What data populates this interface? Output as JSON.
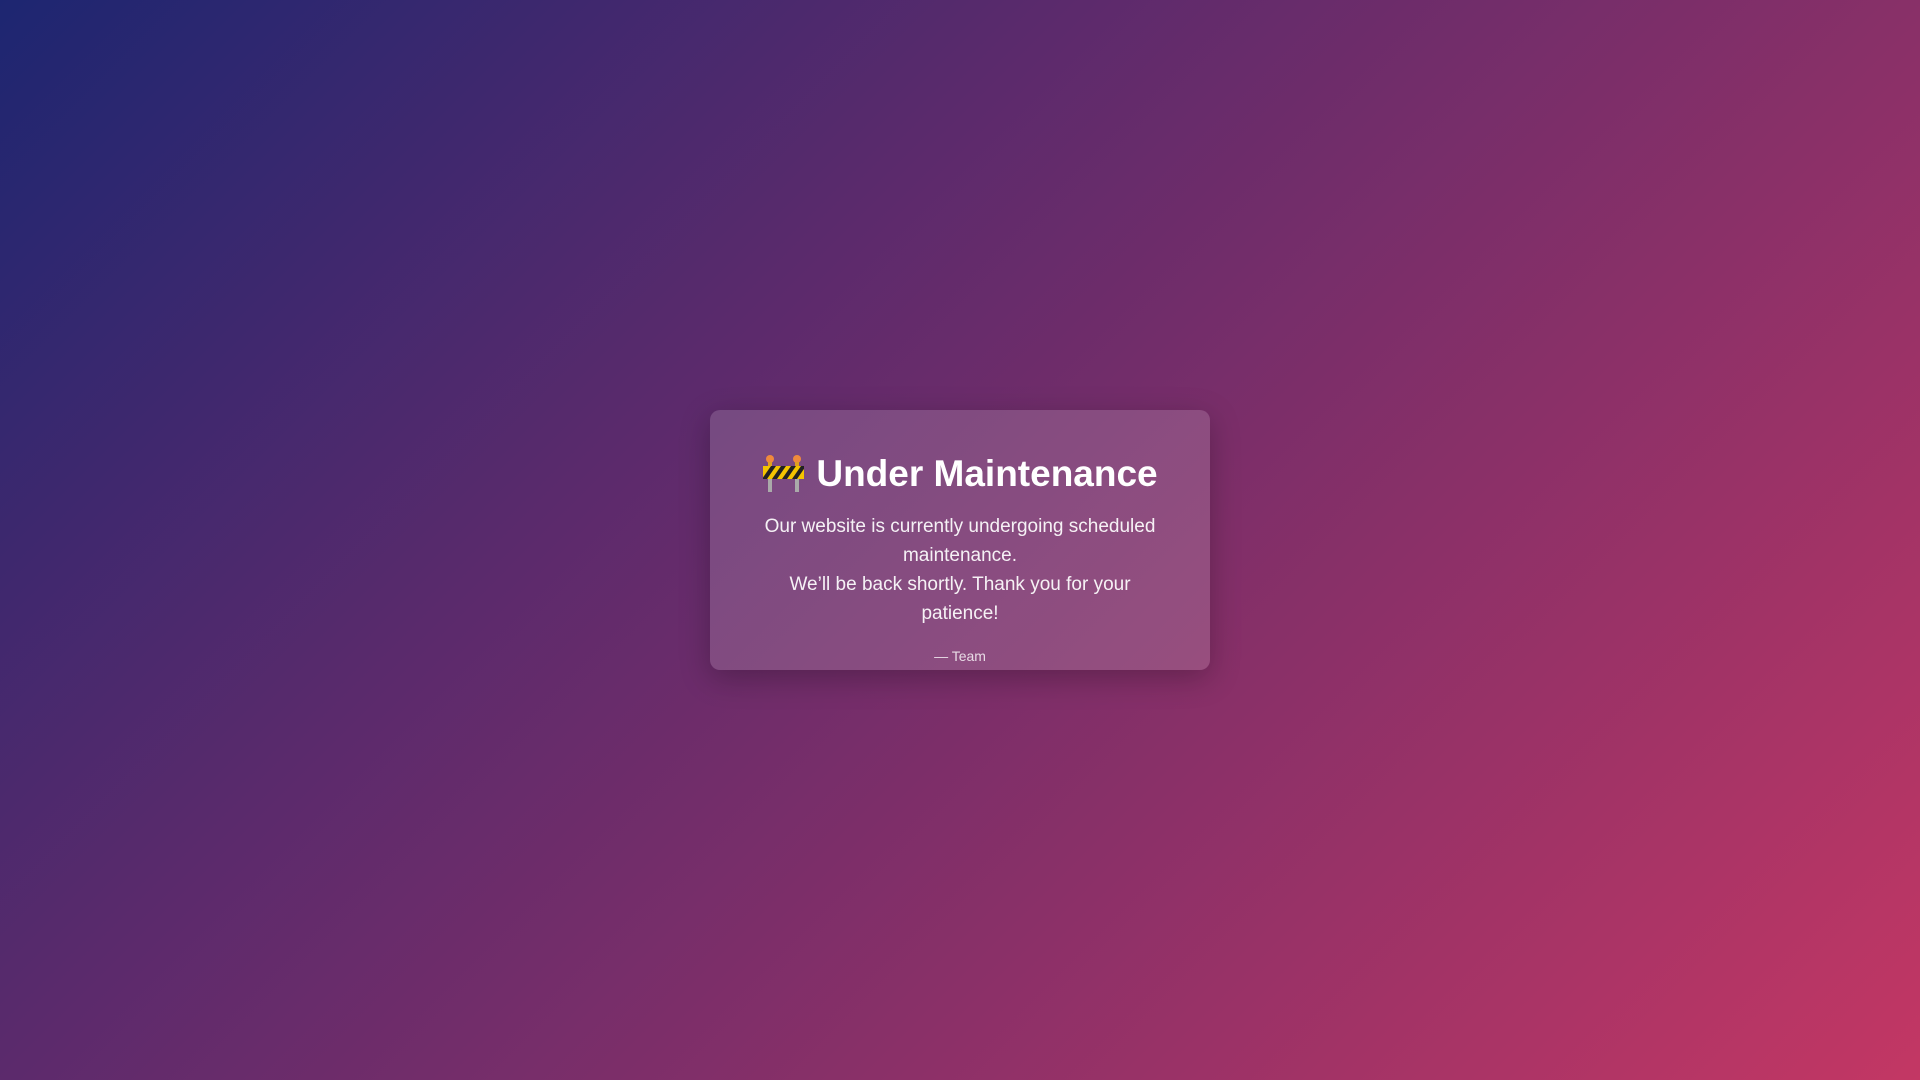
{
  "card": {
    "icon": "construction-barrier-icon",
    "title": "Under Maintenance",
    "message_line1": "Our website is currently undergoing scheduled maintenance.",
    "message_line2": "We’ll be back shortly. Thank you for your patience!",
    "signature": "— Team"
  },
  "colors": {
    "gradient_start": "#1d2671",
    "gradient_end": "#c33764"
  }
}
